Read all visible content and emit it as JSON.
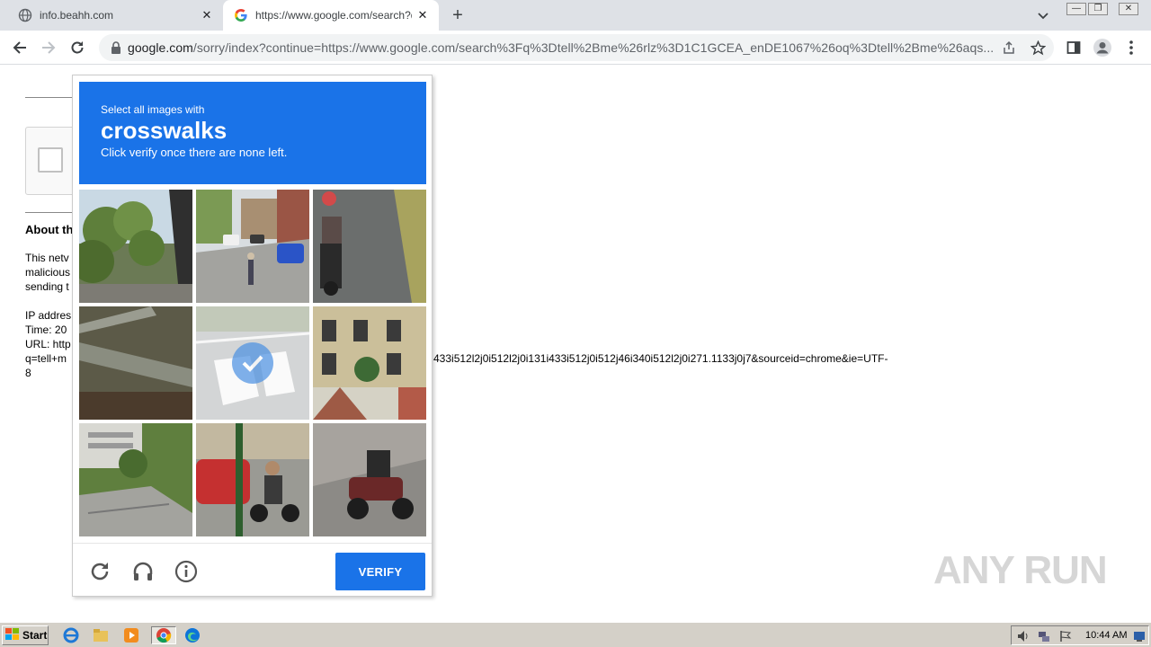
{
  "tabs": [
    {
      "title": "info.beahh.com",
      "favicon": "globe-icon"
    },
    {
      "title": "https://www.google.com/search?q=",
      "favicon": "google-g-icon"
    }
  ],
  "omnibox": {
    "host": "google.com",
    "path": "/sorry/index?continue=https://www.google.com/search%3Fq%3Dtell%2Bme%26rlz%3D1C1GCEA_enDE1067%26oq%3Dtell%2Bme%26aqs..."
  },
  "page": {
    "about_label": "About th",
    "line1": "This netv",
    "line2": "malicious",
    "line3": "sending t",
    "ip_label": "IP addres",
    "time_label": "Time: 20",
    "url_label": "URL: http",
    "url_cont": "q=tell+m",
    "url_tail": "433i512l2j0i512l2j0i131i433i512j0i512j46i340i512l2j0i271.1133j0j7&sourceid=chrome&ie=UTF-",
    "url_end": "8"
  },
  "captcha": {
    "instruction": "Select all images with",
    "target": "crosswalks",
    "hint": "Click verify once there are none left.",
    "verify_label": "VERIFY",
    "tiles": [
      {
        "id": 1,
        "selected": false
      },
      {
        "id": 2,
        "selected": false
      },
      {
        "id": 3,
        "selected": false
      },
      {
        "id": 4,
        "selected": false
      },
      {
        "id": 5,
        "selected": true
      },
      {
        "id": 6,
        "selected": false
      },
      {
        "id": 7,
        "selected": false
      },
      {
        "id": 8,
        "selected": false
      },
      {
        "id": 9,
        "selected": false
      }
    ]
  },
  "watermark": "ANY RUN",
  "taskbar": {
    "start_label": "Start",
    "clock": "10:44 AM"
  },
  "colors": {
    "accent": "#1a73e8",
    "tabstrip": "#dee1e6",
    "taskbar": "#d4d0c8"
  }
}
